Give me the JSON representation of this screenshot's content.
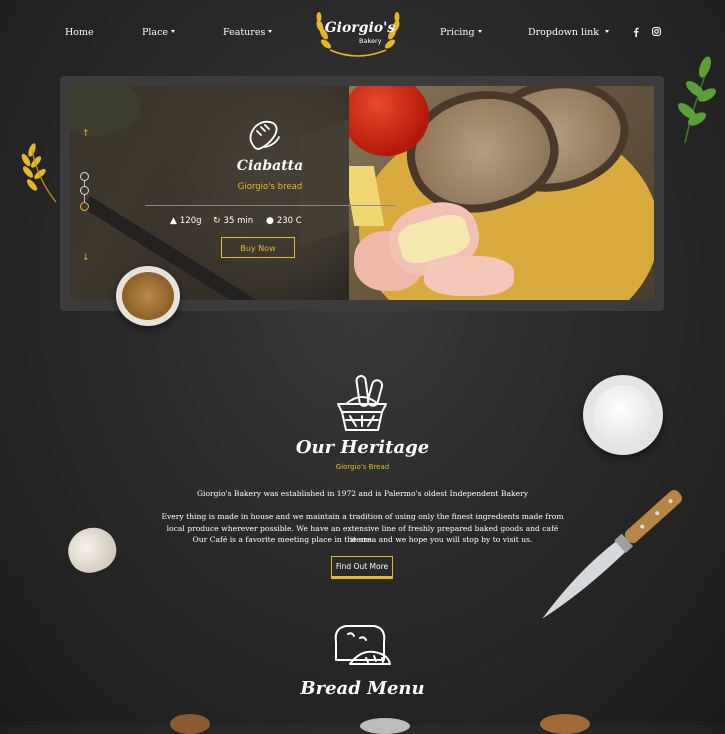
{
  "nav": {
    "items": [
      {
        "label": "Home",
        "dropdown": false
      },
      {
        "label": "Place",
        "dropdown": true
      },
      {
        "label": "Features",
        "dropdown": true
      },
      {
        "label": "Pricing",
        "dropdown": true
      },
      {
        "label": "Dropdown link",
        "dropdown": true
      }
    ],
    "logo": {
      "title": "Giorgio's",
      "subtitle": "Bakery"
    },
    "social": [
      "facebook-icon",
      "instagram-icon"
    ]
  },
  "slider": {
    "title": "Ciabatta",
    "subtitle": "Giorgio's bread",
    "stats": {
      "weight": "120g",
      "time": "35 min",
      "temperature": "230 C"
    },
    "button": "Buy Now"
  },
  "heritage": {
    "title": "Our Heritage",
    "subtitle": "Giorgio's Bread",
    "intro": "Giorgio's Bakery was established in 1972 and is Palermo's oldest Independent Bakery",
    "body_line1": "Every thing is made in house and we maintain a tradition of using only the finest ingredients made from",
    "body_line2": "local produce wherever possible. We have an extensive line of freshly prepared baked goods and café items.",
    "body_line3": "Our Café is a favorite meeting place in the area and we hope you will stop by to visit us.",
    "button": "Find Out More"
  },
  "menu": {
    "title": "Bread Menu"
  },
  "colors": {
    "accent": "#e6b821",
    "background": "#2a2a2a"
  }
}
